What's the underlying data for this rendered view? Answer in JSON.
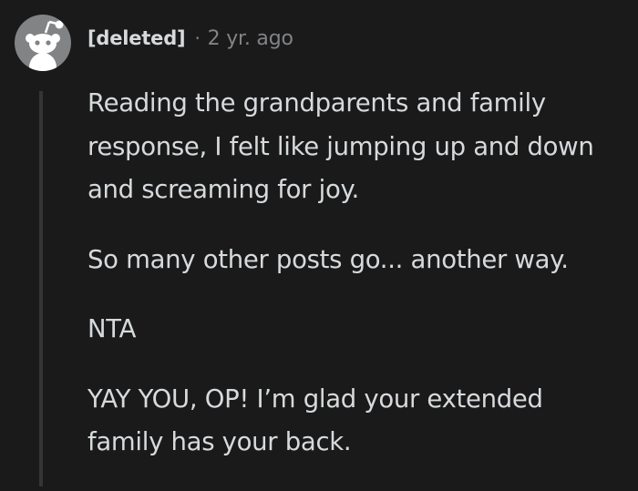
{
  "comment": {
    "author": "[deleted]",
    "separator": "·",
    "age": "2 yr. ago",
    "avatar_icon": "reddit-snoo-icon",
    "paragraphs": [
      "Reading the grandparents and family response, I felt like jumping up and down and screaming for joy.",
      "So many other posts go... another way.",
      "NTA",
      "YAY YOU, OP! I’m glad your extended family has your back."
    ]
  },
  "colors": {
    "background": "#1a1a1b",
    "text": "#d7dadc",
    "meta": "#818384",
    "avatar": "#818384",
    "thread_line": "#343536"
  }
}
